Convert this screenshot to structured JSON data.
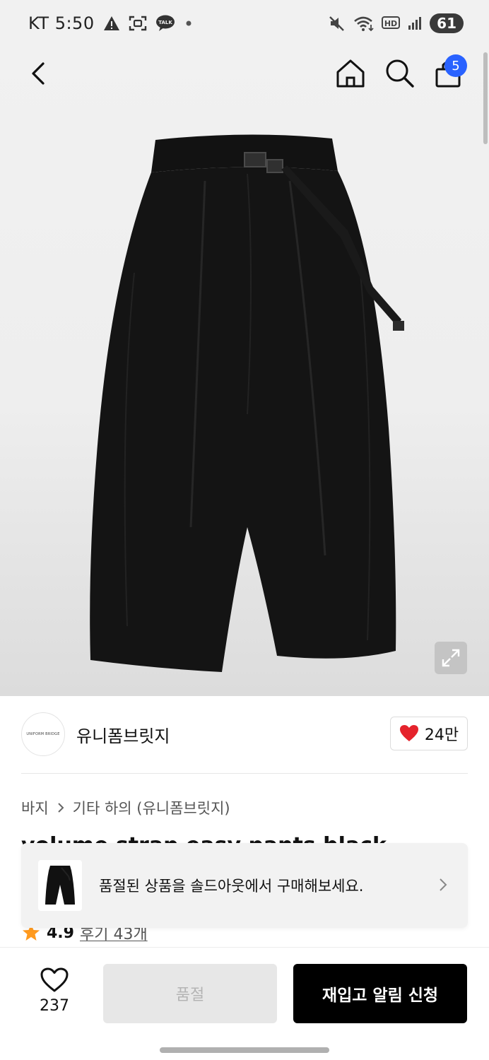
{
  "status_bar": {
    "carrier": "KT",
    "time": "5:50",
    "battery": "61",
    "notification_icons": [
      "warning-icon",
      "screenshot-icon",
      "kakaotalk-icon",
      "dot-icon"
    ],
    "talk_label": "TALK",
    "system_icons": [
      "mute-icon",
      "wifi-icon",
      "hd-icon",
      "signal-icon"
    ],
    "hd_label": "HD"
  },
  "nav": {
    "icons": [
      "back-icon",
      "home-icon",
      "search-icon",
      "shopping-bag-icon"
    ],
    "cart_badge": "5"
  },
  "product_image": {
    "icon": "pants-image",
    "expand_icon": "expand-icon"
  },
  "brand": {
    "logo_text": "UNIFORM BRIDGE",
    "name": "유니폼브릿지",
    "like_count": "24만",
    "like_icon": "heart-filled-icon",
    "heart_color": "#e5232c"
  },
  "category": {
    "parent": "바지",
    "child": "기타 하의 (유니폼브릿지)"
  },
  "product": {
    "title": "volume strap easy pants black",
    "rating": "4.9",
    "review": "후기 43개"
  },
  "soldout_banner": {
    "text": "품절된 상품을 솔드아웃에서 구매해보세요."
  },
  "bottom_bar": {
    "wish_count": "237",
    "soldout_label": "품절",
    "restock_label": "재입고 알림 신청"
  },
  "colors": {
    "badge": "#2962ff",
    "primary_button": "#000000",
    "disabled_button": "#e7e7e7",
    "star": "#ff9a1e"
  }
}
